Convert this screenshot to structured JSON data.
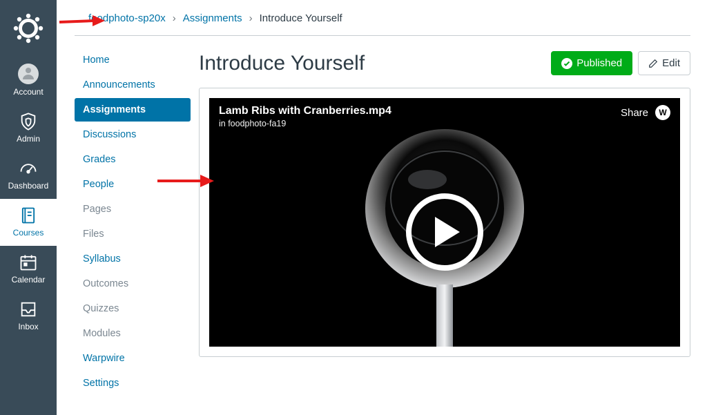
{
  "global_nav": {
    "items": [
      {
        "id": "account",
        "label": "Account"
      },
      {
        "id": "admin",
        "label": "Admin"
      },
      {
        "id": "dashboard",
        "label": "Dashboard"
      },
      {
        "id": "courses",
        "label": "Courses"
      },
      {
        "id": "calendar",
        "label": "Calendar"
      },
      {
        "id": "inbox",
        "label": "Inbox"
      }
    ]
  },
  "breadcrumb": {
    "course": "foodphoto-sp20x",
    "section": "Assignments",
    "current": "Introduce Yourself"
  },
  "course_nav": {
    "items": [
      {
        "label": "Home"
      },
      {
        "label": "Announcements"
      },
      {
        "label": "Assignments",
        "active": true
      },
      {
        "label": "Discussions"
      },
      {
        "label": "Grades"
      },
      {
        "label": "People"
      },
      {
        "label": "Pages",
        "disabled": true
      },
      {
        "label": "Files",
        "disabled": true
      },
      {
        "label": "Syllabus"
      },
      {
        "label": "Outcomes",
        "disabled": true
      },
      {
        "label": "Quizzes",
        "disabled": true
      },
      {
        "label": "Modules",
        "disabled": true
      },
      {
        "label": "Warpwire"
      },
      {
        "label": "Settings"
      }
    ]
  },
  "page": {
    "title": "Introduce Yourself",
    "published_label": "Published",
    "edit_label": "Edit"
  },
  "video": {
    "title": "Lamb Ribs with Cranberries.mp4",
    "subtitle": "in foodphoto-fa19",
    "share_label": "Share",
    "badge_letter": "W"
  }
}
